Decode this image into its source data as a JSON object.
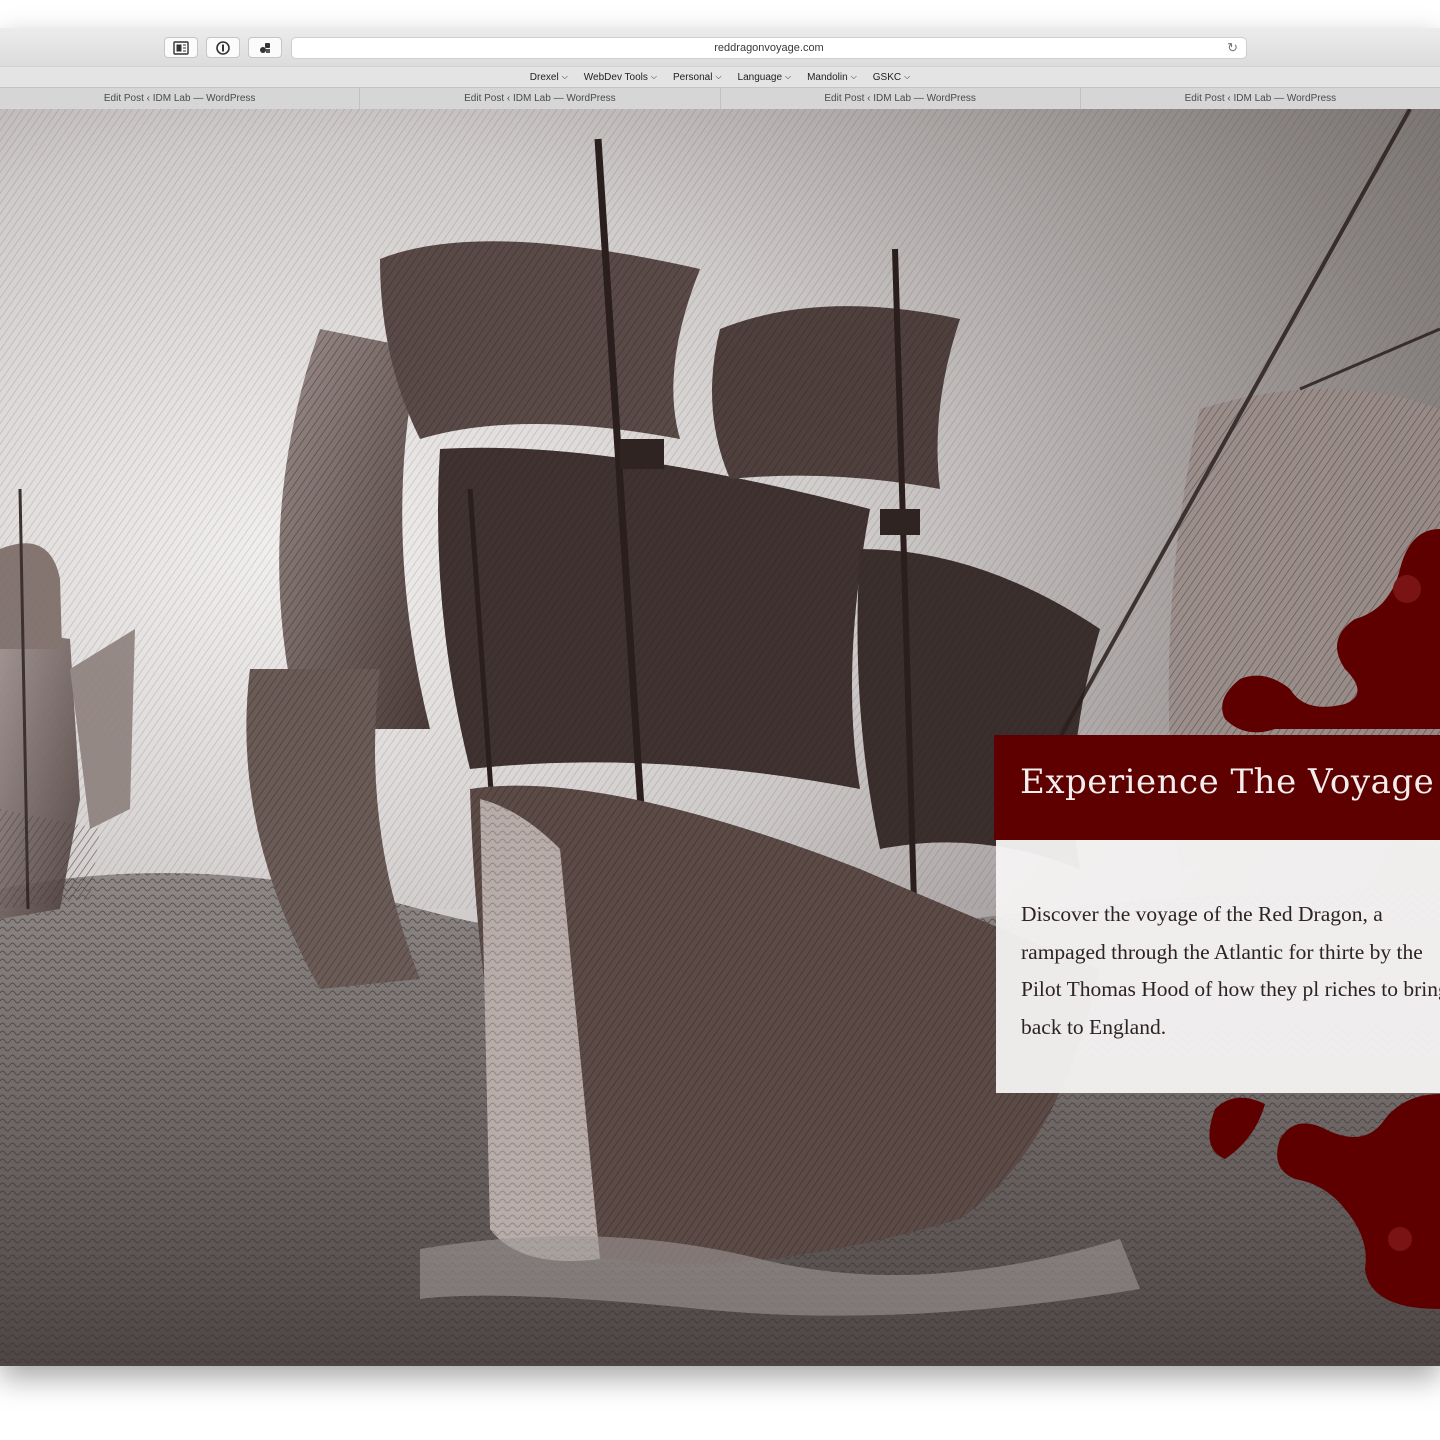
{
  "browser": {
    "toolbar_icons": [
      "reader-icon",
      "info-icon",
      "extension-icon"
    ],
    "address": "reddragonvoyage.com",
    "reload_icon": "reload-icon"
  },
  "favorites": [
    {
      "label": "Drexel"
    },
    {
      "label": "WebDev Tools"
    },
    {
      "label": "Personal"
    },
    {
      "label": "Language"
    },
    {
      "label": "Mandolin"
    },
    {
      "label": "GSKC"
    }
  ],
  "tabs": [
    {
      "label": "Edit Post ‹ IDM Lab — WordPress"
    },
    {
      "label": "Edit Post ‹ IDM Lab — WordPress"
    },
    {
      "label": "Edit Post ‹ IDM Lab — WordPress"
    },
    {
      "label": "Edit Post ‹ IDM Lab — WordPress"
    }
  ],
  "hero": {
    "card_title": "Experience The Voyage",
    "card_text": "Discover the voyage of the Red Dragon, a rampaged through the Atlantic for thirte by the Pilot Thomas Hood of how they pl riches to bring back to England."
  },
  "colors": {
    "accent": "#5e0000",
    "card_bg": "#f5f3f3",
    "engraving_ink": "#3a2c2a"
  }
}
